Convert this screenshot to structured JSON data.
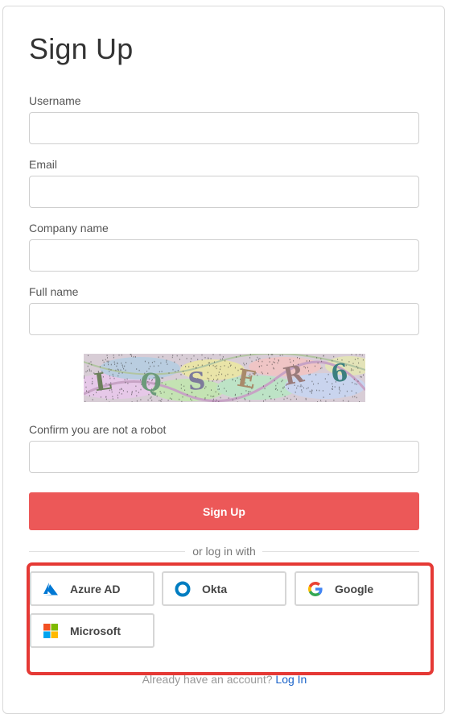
{
  "form": {
    "title": "Sign Up",
    "fields": [
      {
        "label": "Username",
        "value": "",
        "placeholder": ""
      },
      {
        "label": "Email",
        "value": "",
        "placeholder": ""
      },
      {
        "label": "Company name",
        "value": "",
        "placeholder": ""
      },
      {
        "label": "Full name",
        "value": "",
        "placeholder": ""
      }
    ],
    "captcha": {
      "text": "LQSER6"
    },
    "robot_label": "Confirm you are not a robot",
    "robot_value": "",
    "submit_label": "Sign Up",
    "submit_color": "#ec5858"
  },
  "sso": {
    "divider_text": "or log in with",
    "providers": [
      {
        "label": "Azure AD",
        "icon": "azure-icon"
      },
      {
        "label": "Okta",
        "icon": "okta-icon"
      },
      {
        "label": "Google",
        "icon": "google-icon"
      },
      {
        "label": "Microsoft",
        "icon": "microsoft-icon"
      }
    ],
    "highlight_color": "#e53935"
  },
  "footer": {
    "text": "Already have an account?",
    "link_label": "Log In",
    "link_color": "#1a63c9"
  }
}
